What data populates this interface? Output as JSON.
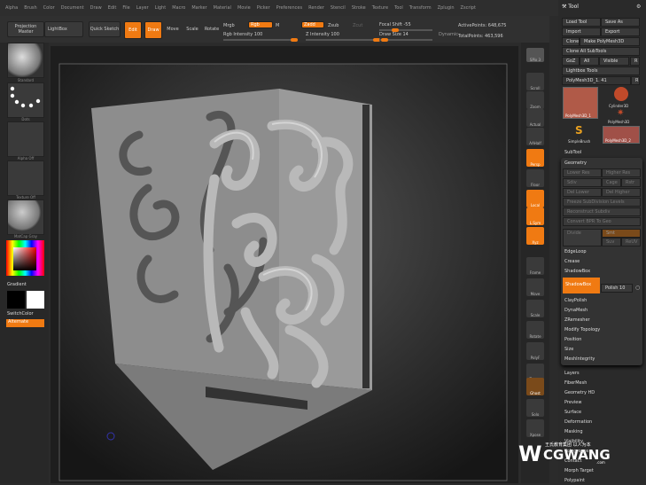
{
  "menu": [
    "Alpha",
    "Brush",
    "Color",
    "Document",
    "Draw",
    "Edit",
    "File",
    "Layer",
    "Light",
    "Macro",
    "Marker",
    "Material",
    "Movie",
    "Picker",
    "Preferences",
    "Render",
    "Stencil",
    "Stroke",
    "Texture",
    "Tool",
    "Transform",
    "Zplugin",
    "Zscript"
  ],
  "toolbar": {
    "projection_master": "Projection Master",
    "lightbox": "LightBox",
    "quick_sketch": "Quick Sketch",
    "edit": "Edit",
    "draw": "Draw",
    "move": "Move",
    "scale": "Scale",
    "rotate": "Rotate",
    "mrgb_label": "Mrgb",
    "rgb": "Rgb",
    "m": "M",
    "zadd": "Zadd",
    "zsub": "Zsub",
    "zcut": "Zcut",
    "rgb_intensity": "Rgb Intensity 100",
    "z_intensity": "Z Intensity 100",
    "focal_shift": "Focal Shift -55",
    "draw_size": "Draw Size 14",
    "dynamic": "Dynamic",
    "active_points": "ActivePoints: 648,675",
    "total_points": "TotalPoints: 463,596",
    "rgb_intensity_value": 100,
    "z_intensity_value": 100,
    "focal_shift_value": -55,
    "draw_size_value": 14
  },
  "left_shelf": {
    "brush": "Standard",
    "stroke": "Dots",
    "alpha": "Alpha Off",
    "texture": "Texture Off",
    "material": "MatCap Gray",
    "gradient": "Gradient",
    "switch_color": "SwitchColor",
    "alternate": "Alternate"
  },
  "right_shelf": [
    {
      "label": "SPix 3",
      "active": false
    },
    {
      "label": "Scroll",
      "active": false
    },
    {
      "label": "Zoom",
      "active": false
    },
    {
      "label": "Actual",
      "active": false
    },
    {
      "label": "AAHalf",
      "active": false
    },
    {
      "label": "Persp",
      "active": true
    },
    {
      "label": "Floor",
      "active": false
    },
    {
      "label": "Local",
      "active": true
    },
    {
      "label": "L.Sym",
      "active": true
    },
    {
      "label": "Xyz",
      "active": true
    },
    {
      "label": "Frame",
      "active": false
    },
    {
      "label": "Move",
      "active": false
    },
    {
      "label": "Scale",
      "active": false
    },
    {
      "label": "Rotate",
      "active": false
    },
    {
      "label": "PolyF",
      "active": false
    },
    {
      "label": "Transp",
      "active": false
    },
    {
      "label": "Ghost",
      "active": true
    },
    {
      "label": "Solo",
      "active": false
    },
    {
      "label": "Xpose",
      "active": false
    }
  ],
  "panel": {
    "title": "Tool",
    "load_tool": "Load Tool",
    "save_as": "Save As",
    "import": "Import",
    "export": "Export",
    "clone": "Clone",
    "make_polymesh": "Make PolyMesh3D",
    "clone_all": "Clone All SubTools",
    "goz": "GoZ",
    "all": "All",
    "visible": "Visible",
    "r": "R",
    "lightbox_tools": "Lightbox Tools",
    "current_tool": "PolyMesh3D_1. 41",
    "tools": [
      "PolyMesh3D_1",
      "Cylinder3D",
      "PolyMesh3D",
      "SimpleBrush",
      "PolyMesh3D_2"
    ],
    "subtool": "SubTool",
    "geometry": "Geometry",
    "geo_buttons": [
      "Lower Res",
      "Higher Res",
      "Sdiv",
      "Cage",
      "Rstr",
      "Del Lower",
      "Del Higher",
      "Freeze SubDivision Levels",
      "Reconstruct Subdiv",
      "Convert BPR To Geo",
      "Divide",
      "Smt",
      "Suv",
      "ReUV"
    ],
    "sections": [
      "EdgeLoop",
      "Crease",
      "ShadowBox"
    ],
    "shadowbox": "ShadowBox",
    "polish": "Polish 10",
    "more": [
      "ClayPolish",
      "DynaMesh",
      "ZRemesher",
      "Modify Topology",
      "Position",
      "Size",
      "MeshIntegrity"
    ],
    "outer": [
      "Layers",
      "FiberMesh",
      "Geometry HD",
      "Preview",
      "Surface",
      "Deformation",
      "Masking",
      "Visibility",
      "Polygroups",
      "Contact",
      "Morph Target",
      "Polypaint"
    ]
  },
  "watermark": {
    "text": "CGWANG",
    "sub": "王氏教育集团 以人为本",
    "domain": ".com"
  },
  "colors": {
    "accent": "#f07a12",
    "bg": "#2b2b2b"
  }
}
